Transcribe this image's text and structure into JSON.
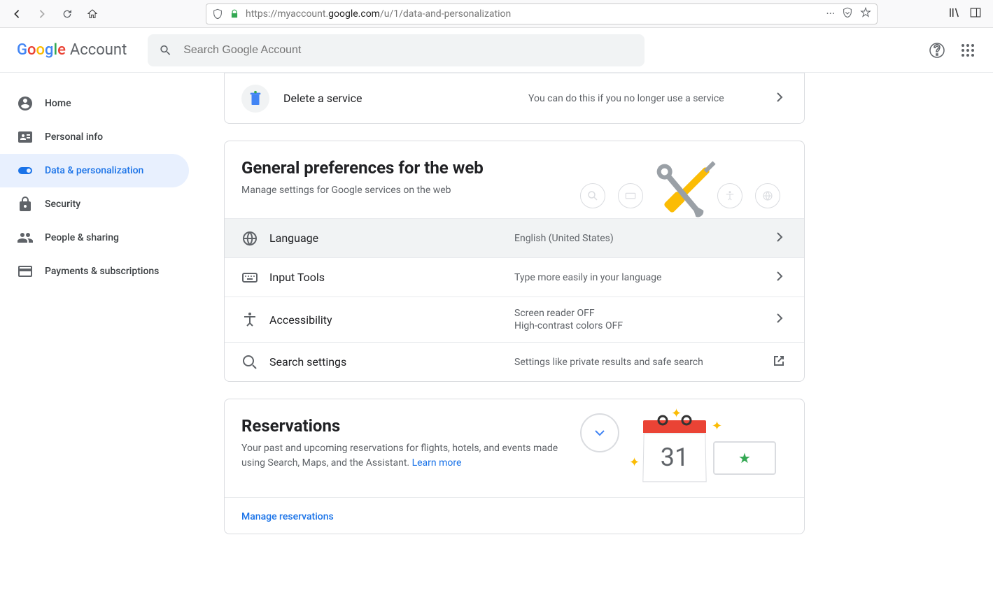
{
  "browser": {
    "url_prefix": "https://myaccount.",
    "url_domain": "google.com",
    "url_path": "/u/1/data-and-personalization"
  },
  "header": {
    "logo_text": "Google",
    "logo_suffix": "Account",
    "search_placeholder": "Search Google Account"
  },
  "sidebar": {
    "items": [
      {
        "label": "Home"
      },
      {
        "label": "Personal info"
      },
      {
        "label": "Data & personalization"
      },
      {
        "label": "Security"
      },
      {
        "label": "People & sharing"
      },
      {
        "label": "Payments & subscriptions"
      }
    ]
  },
  "delete_service": {
    "label": "Delete a service",
    "desc": "You can do this if you no longer use a service"
  },
  "prefs": {
    "title": "General preferences for the web",
    "subtitle": "Manage settings for Google services on the web",
    "rows": {
      "language": {
        "label": "Language",
        "value": "English (United States)"
      },
      "input_tools": {
        "label": "Input Tools",
        "value": "Type more easily in your language"
      },
      "accessibility": {
        "label": "Accessibility",
        "value1": "Screen reader OFF",
        "value2": "High-contrast colors OFF"
      },
      "search": {
        "label": "Search settings",
        "value": "Settings like private results and safe search"
      }
    }
  },
  "reservations": {
    "title": "Reservations",
    "subtitle_text": "Your past and upcoming reservations for flights, hotels, and events made using Search, Maps, and the Assistant. ",
    "learn_more": "Learn more",
    "calendar_day": "31",
    "manage_link": "Manage reservations"
  }
}
